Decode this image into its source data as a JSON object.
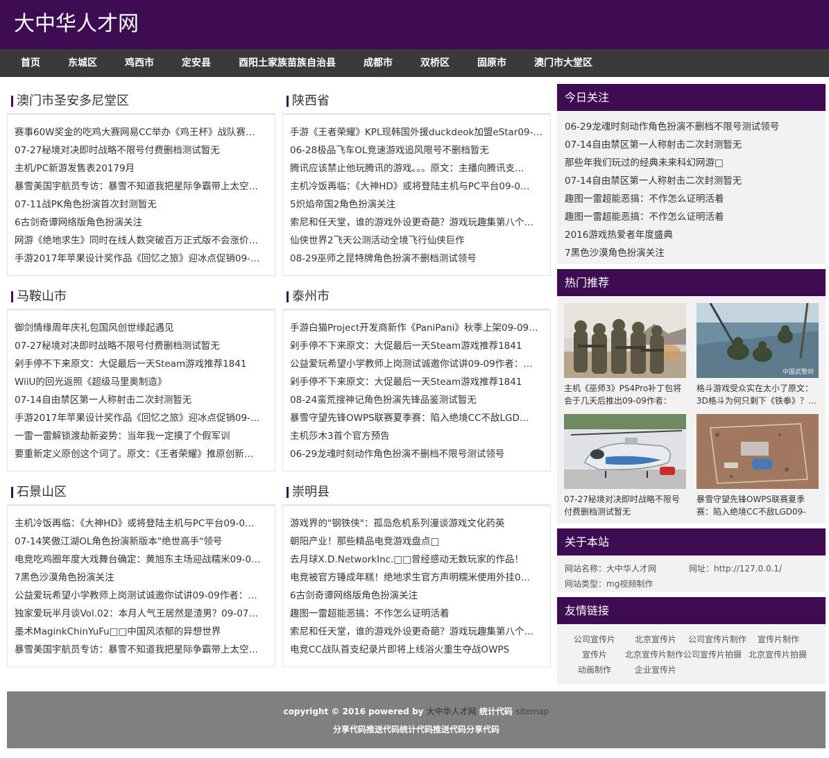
{
  "site": {
    "title": "大中华人才网"
  },
  "nav": [
    "首页",
    "东城区",
    "鸡西市",
    "定安县",
    "酉阳土家族苗族自治县",
    "成都市",
    "双桥区",
    "固原市",
    "澳门市大堂区"
  ],
  "sections": [
    {
      "title": "澳门市圣安多尼堂区",
      "items": [
        "赛事60W奖金的吃鸡大赛网易CC举办《鸡王杯》战队赛…",
        "07-27秘境对决即时战略不限号付费删档测试暂无",
        "主机/PC新游发售表20179月",
        "暴雪美国宇航员专访：暴雪不知道我把星际争霸带上太空…",
        "07-11战PK角色扮演首次封测暂无",
        "6古剑奇谭网络版角色扮演关注",
        "网游《绝地求生》同时在线人数突破百万正式版不会涨价…",
        "手游2017年苹果设计奖作品《回忆之旅》迎冰点促销09-…"
      ]
    },
    {
      "title": "陕西省",
      "items": [
        "手游《王者荣耀》KPL现韩国外援duckdeok加盟eStar09-…",
        "06-28极品飞车OL竞速游戏追风限号不删档暂无",
        "腾讯应该禁止他玩腾讯的游戏。。。原文：主播向腾讯支…",
        "主机冷饭再临：《大神HD》或将登陆主机与PC平台09-0…",
        "5炽焰帝国2角色扮演关注",
        "索尼和任天堂，谁的游戏外设更奇葩？游戏玩趣集第八个…",
        "仙侠世界2飞天公测活动全境飞行仙侠巨作",
        "08-29巫师之昆特牌角色扮演不删档测试领号"
      ]
    },
    {
      "title": "马鞍山市",
      "items": [
        "御剑情缘周年庆礼包国风创世缘起遇见",
        "07-27秘境对决即时战略不限号付费删档测试暂无",
        "剁手停不下来原文：大促最后一天Steam游戏推荐1841",
        "WiiU的回光返照《超级马里奥制造》",
        "07-14自由禁区第一人称射击二次封测暂无",
        "手游2017年苹果设计奖作品《回忆之旅》迎冰点促销09-…",
        "一雷一雷解锁渡劫新姿势：当年我一定摸了个假军训",
        "要重新定义原创这个词了。原文：《王者荣耀》推原创新…"
      ]
    },
    {
      "title": "泰州市",
      "items": [
        "手游白猫Project开发商新作《PaniPani》秋季上架09-09…",
        "剁手停不下来原文：大促最后一天Steam游戏推荐1841",
        "公益爱玩希望小学教师上岗测试诚邀你试讲09-09作者：…",
        "剁手停不下来原文：大促最后一天Steam游戏推荐1841",
        "08-24蛮荒搜神记角色扮演先锋品鉴测试暂无",
        "暴雪守望先锋OWPS联赛夏季赛：陷入绝境CC不敌LGD…",
        "主机莎木3首个官方预告",
        "06-29龙魂时刻动作角色扮演不删档不限号测试领号"
      ]
    },
    {
      "title": "石景山区",
      "items": [
        "主机冷饭再临：《大神HD》或将登陆主机与PC平台09-0…",
        "07-14笑傲江湖OL角色扮演新版本\"绝世高手\"领号",
        "电竞吃鸡圈年度大戏舞台确定：黄旭东主场迎战糯米09-0…",
        "7黑色沙漠角色扮演关注",
        "公益爱玩希望小学教师上岗测试诚邀你试讲09-09作者：…",
        "独家爱玩半月谈Vol.02：本月人气王居然是渣男？09-07…",
        "墨术MaginkChinYuFu□□中国风浓郁的异想世界",
        "暴雪美国宇航员专访：暴雪不知道我把星际争霸带上太空…"
      ]
    },
    {
      "title": "崇明县",
      "items": [
        "游戏界的\"钢铁侠\"：孤岛危机系列漫谈游戏文化药英",
        "朝阳产业！那些精品电竞游戏盘点□",
        "去月球X.D.NetworkInc.□□曾经感动无数玩家的作品！",
        "电竞被官方锤成年糕！绝地求生官方声明糯米使用外挂0…",
        "6古剑奇谭网络版角色扮演关注",
        "趣图一雷超能恶搞：不作怎么证明活着",
        "索尼和任天堂，谁的游戏外设更奇葩？游戏玩趣集第八个…",
        "电竞CC战队首支纪录片即将上线浴火重生夺战OWPS"
      ]
    }
  ],
  "sidebar": {
    "focus_title": "今日关注",
    "focus_items": [
      "06-29龙魂时刻动作角色扮演不删档不限号测试领号",
      "07-14自由禁区第一人称射击二次封测暂无",
      "那些年我们玩过的经典未来科幻网游□",
      "07-14自由禁区第一人称射击二次封测暂无",
      "趣图一雷超能恶搞：不作怎么证明活着",
      "趣图一雷超能恶搞：不作怎么证明活着",
      "2016游戏热爱者年度盛典",
      "7黑色沙漠角色扮演关注"
    ],
    "hot_title": "热门推荐",
    "hot_items": [
      {
        "caption": "主机《巫师3》PS4Pro补丁包将会于几天后推出09-09作者：华…",
        "image": "soldiers-photo"
      },
      {
        "caption": "格斗游戏受众实在太小了原文：3D格斗为何只剩下《铁拳》？…",
        "image": "soldiers-boat-photo",
        "watermark": "中国武警网"
      },
      {
        "caption": "07-27秘境对决即时战略不限号付费删档测试暂无",
        "image": "helicopter-photo"
      },
      {
        "caption": "暴雪守望先锋OWPS联赛夏季赛：陷入绝境CC不敌LGD09-0…",
        "image": "aerial-base-photo"
      }
    ],
    "about_title": "关于本站",
    "about": {
      "name_label": "网站名称：",
      "name": "大中华人才网",
      "url_label": "网址：",
      "url": "http://127.0.0.1/",
      "type_label": "网站类型：",
      "type": "mg视频制作"
    },
    "links_title": "友情链接",
    "links": [
      "公司宣传片",
      "北京宣传片",
      "公司宣传片制作",
      "宣传片制作",
      "宣传片",
      "北京宣传片制作",
      "公司宣传片拍摄",
      "北京宣传片拍摄",
      "动画制作",
      "企业宣传片"
    ]
  },
  "footer": {
    "copyright": "copyright © 2016 powered by",
    "site": "大中华人才网",
    "stats": "统计代码",
    "sitemap": "sitemap",
    "line2": "分享代码推送代码统计代码推送代码分享代码"
  },
  "colors": {
    "brand": "#3d0c52",
    "nav_bg": "#3a3a3a",
    "footer_bg": "#808080",
    "panel_bg": "#f2f2f2"
  }
}
